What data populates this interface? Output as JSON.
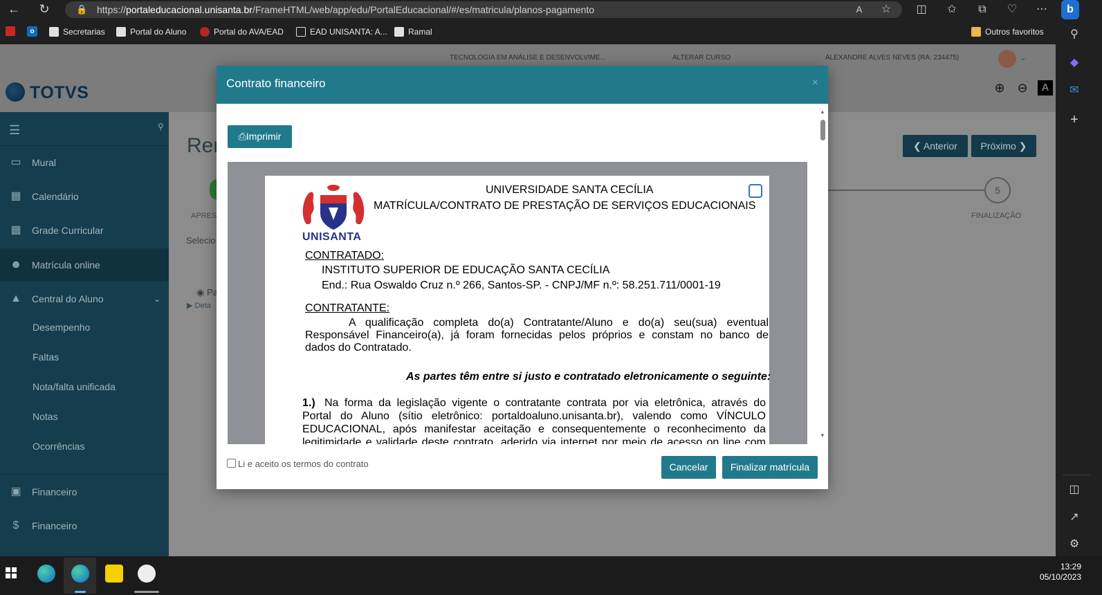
{
  "browser": {
    "url_prefix": "https://",
    "url_host": "portaleducacional.unisanta.br",
    "url_path": "/FrameHTML/web/app/edu/PortalEducacional/#/es/matricula/planos-pagamento",
    "read_aloud": "A",
    "bookmarks": [
      "Secretarias",
      "Portal do Aluno",
      "Portal do AVA/EAD",
      "EAD UNISANTA: A...",
      "Ramal"
    ],
    "other_favorites": "Outros favoritos"
  },
  "header": {
    "course": "TECNOLOGIA EM ANÁLISE E DESENVOLVIME...",
    "change_course": "ALTERAR CURSO",
    "student": "ALEXANDRE ALVES NEVES (RA: 234475)",
    "logo": "TOTVS"
  },
  "sidebar": {
    "items": [
      {
        "label": "Mural",
        "icon": "monitor-icon"
      },
      {
        "label": "Calendário",
        "icon": "calendar-icon"
      },
      {
        "label": "Grade Curricular",
        "icon": "grid-icon"
      },
      {
        "label": "Matrícula online",
        "icon": "user-plus-icon"
      },
      {
        "label": "Central do Aluno",
        "icon": "graduation-cap-icon"
      }
    ],
    "sub_items": [
      "Desempenho",
      "Faltas",
      "Nota/falta unificada",
      "Notas",
      "Ocorrências"
    ],
    "finance_items": [
      "Financeiro",
      "Financeiro"
    ]
  },
  "page": {
    "title_partial": "Rer",
    "step1_partial": "APRES",
    "select_partial": "Selecio",
    "radio_partial": "Pa",
    "detail_partial": "Deta",
    "prev_label": "Anterior",
    "next_label": "Próximo",
    "step5_number": "5",
    "step5_label": "FINALIZAÇÃO"
  },
  "modal": {
    "title": "Contrato financeiro",
    "close": "×",
    "print_label": "Imprimir",
    "accept_label": "Li e aceito os termos do contrato",
    "cancel_label": "Cancelar",
    "finish_label": "Finalizar matrícula"
  },
  "document": {
    "logo_text": "UNISANTA",
    "heading1": "UNIVERSIDADE SANTA CECÍLIA",
    "heading2": "MATRÍCULA/CONTRATO DE PRESTAÇÃO DE SERVIÇOS EDUCACIONAIS",
    "contratado_label": "CONTRATADO:",
    "contratado_name": "INSTITUTO SUPERIOR DE EDUCAÇÃO SANTA CECÍLIA",
    "contratado_address": "End.: Rua Oswaldo Cruz n.º 266, Santos-SP. - CNPJ/MF n.º: 58.251.711/0001-19",
    "contratante_label": "CONTRATANTE:",
    "contratante_line1": "A qualificação completa do(a) Contratante/Aluno e do(a) seu(sua) eventual",
    "contratante_line2": "Responsável Financeiro(a), já foram fornecidas pelos próprios e constam no banco de",
    "contratante_line3": "dados do Contratado.",
    "agreement": "As partes têm entre si justo e contratado eletronicamente o seguinte:",
    "clause1_num": "1.)",
    "clause1_line1": "Na forma da legislação vigente o contratante contrata por via eletrônica, através do",
    "clause1_line2": "Portal do Aluno (sítio eletrônico: portaldoaluno.unisanta.br), valendo como VÍNCULO",
    "clause1_line3": "EDUCACIONAL, após manifestar aceitação e consequentemente o reconhecimento da",
    "clause1_line4": "legitimidade e validade deste contrato, aderido via internet por meio de acesso on line com"
  },
  "taskbar": {
    "time": "13:29",
    "date": "05/10/2023"
  }
}
